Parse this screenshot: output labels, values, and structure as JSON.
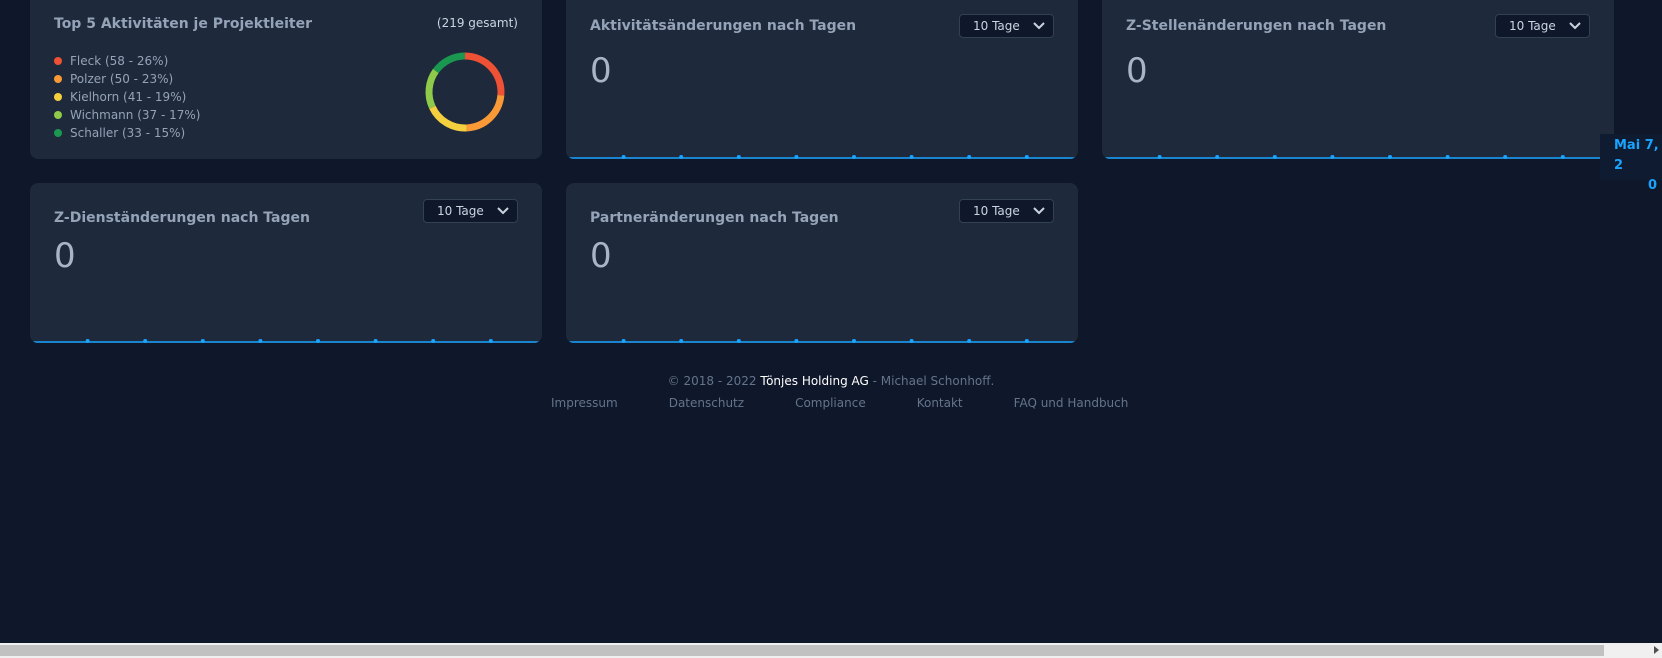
{
  "card_projektleiter": {
    "title": "Top 5 Aktivitäten je Projektleiter",
    "total": "(219 gesamt)",
    "legend": [
      {
        "label": "Fleck (58 - 26%)",
        "value": 58,
        "color": "#ef5134"
      },
      {
        "label": "Polzer (50 - 23%)",
        "value": 50,
        "color": "#f99a36"
      },
      {
        "label": "Kielhorn (41 - 19%)",
        "value": 41,
        "color": "#f4d03f"
      },
      {
        "label": "Wichmann (37 - 17%)",
        "value": 37,
        "color": "#8fca4a"
      },
      {
        "label": "Schaller (33 - 15%)",
        "value": 33,
        "color": "#1a9850"
      }
    ]
  },
  "cards": [
    {
      "title": "Aktivitätsänderungen nach Tagen",
      "select": "10 Tage",
      "value": "0"
    },
    {
      "title": "Z-Stellenänderungen nach Tagen",
      "select": "10 Tage",
      "value": "0"
    },
    {
      "title": "Z-Dienständerungen nach Tagen",
      "select": "10 Tage",
      "value": "0"
    },
    {
      "title": "Partneränderungen nach Tagen",
      "select": "10 Tage",
      "value": "0"
    }
  ],
  "sparkline": {
    "values": [
      0,
      0,
      0,
      0,
      0,
      0,
      0,
      0,
      0,
      0
    ],
    "color": "#1aa3ff"
  },
  "tooltip": {
    "date": "Mai 7, 2",
    "value": "0"
  },
  "footer": {
    "copyright_prefix": "© 2018 - 2022 ",
    "brand": "Tönjes Holding AG",
    "suffix": " - Michael Schonhoff.",
    "links": [
      "Impressum",
      "Datenschutz",
      "Compliance",
      "Kontakt",
      "FAQ und Handbuch"
    ]
  },
  "colors": {
    "background": "#0f172a",
    "card": "#1e293b",
    "accent": "#1aa3ff"
  }
}
